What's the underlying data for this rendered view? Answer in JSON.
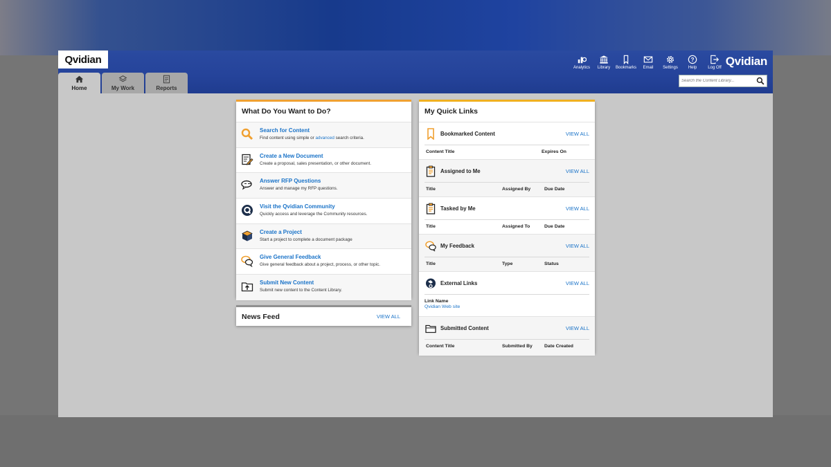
{
  "brand": {
    "logo": "Qvidian",
    "logo_right": "Qvidian"
  },
  "tabs": [
    {
      "label": "Home",
      "icon": "home-icon",
      "active": true
    },
    {
      "label": "My Work",
      "icon": "layers-icon",
      "active": false
    },
    {
      "label": "Reports",
      "icon": "report-icon",
      "active": false
    }
  ],
  "toolbar": [
    {
      "label": "Analytics",
      "icon": "analytics-icon"
    },
    {
      "label": "Library",
      "icon": "library-icon"
    },
    {
      "label": "Bookmarks",
      "icon": "bookmark-icon"
    },
    {
      "label": "Email",
      "icon": "email-icon"
    },
    {
      "label": "Settings",
      "icon": "gear-icon"
    },
    {
      "label": "Help",
      "icon": "help-icon"
    },
    {
      "label": "Log Off",
      "icon": "logoff-icon"
    }
  ],
  "search": {
    "placeholder": "Search the Content Library..."
  },
  "todo": {
    "title": "What Do You Want to Do?",
    "items": [
      {
        "title": "Search for Content",
        "desc_pre": "Find content using simple or ",
        "desc_link": "advanced",
        "desc_post": " search criteria.",
        "icon": "search-icon"
      },
      {
        "title": "Create a New Document",
        "desc": "Create a proposal, sales presentation, or other document.",
        "icon": "document-edit-icon"
      },
      {
        "title": "Answer RFP Questions",
        "desc": "Answer and manage my RFP questions.",
        "icon": "chat-bubbles-icon"
      },
      {
        "title": "Visit the Qvidian Community",
        "desc": "Quickly access and leverage the Community resources.",
        "icon": "community-icon"
      },
      {
        "title": "Create a Project",
        "desc": "Start a project to complete a document package",
        "icon": "project-box-icon"
      },
      {
        "title": "Give General Feedback",
        "desc": "Give general feedback about a project, process, or other topic.",
        "icon": "feedback-icon"
      },
      {
        "title": "Submit New Content",
        "desc": "Submit new content to the Content Library.",
        "icon": "upload-folder-icon"
      }
    ]
  },
  "news": {
    "title": "News Feed",
    "view_all": "VIEW ALL"
  },
  "quick_links": {
    "title": "My Quick Links",
    "view_all": "VIEW ALL",
    "bookmarked": {
      "title": "Bookmarked Content",
      "cols": [
        "Content Title",
        "Expires On"
      ]
    },
    "assigned": {
      "title": "Assigned to Me",
      "cols": [
        "Title",
        "Assigned By",
        "Due Date"
      ]
    },
    "tasked": {
      "title": "Tasked by Me",
      "cols": [
        "Title",
        "Assigned To",
        "Due Date"
      ]
    },
    "feedback": {
      "title": "My Feedback",
      "cols": [
        "Title",
        "Type",
        "Status"
      ]
    },
    "external": {
      "title": "External Links",
      "label": "Link Name",
      "link": "Qvidian Web site"
    },
    "submitted": {
      "title": "Submitted Content",
      "cols": [
        "Content Title",
        "Submitted By",
        "Date Created"
      ]
    }
  },
  "colors": {
    "accent_orange": "#f0a030",
    "link_blue": "#1a73c8",
    "header_blue": "#25439a"
  }
}
